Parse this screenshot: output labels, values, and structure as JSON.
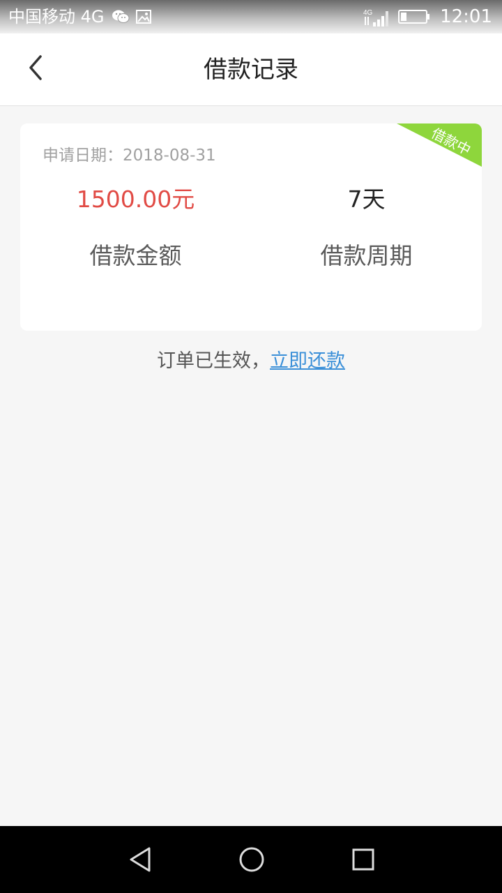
{
  "status_bar": {
    "carrier": "中国移动 4G",
    "network": "4G",
    "time": "12:01"
  },
  "header": {
    "title": "借款记录"
  },
  "loan_card": {
    "ribbon": "借款中",
    "apply_date_label": "申请日期：",
    "apply_date": "2018-08-31",
    "amount_value": "1500.00元",
    "amount_caption": "借款金额",
    "period_value": "7天",
    "period_caption": "借款周期"
  },
  "order_status": {
    "text": "订单已生效，",
    "link": "立即还款"
  },
  "colors": {
    "amount": "#e14b45",
    "link": "#3a8fd8",
    "ribbon": "#8ed63c",
    "background": "#f6f6f6"
  },
  "icons": {
    "status_left": [
      "wechat-icon",
      "image-icon"
    ],
    "status_right": [
      "signal-icon",
      "battery-icon"
    ],
    "nav": [
      "back-icon"
    ],
    "system_nav": [
      "back-triangle-icon",
      "home-circle-icon",
      "recent-square-icon"
    ]
  }
}
